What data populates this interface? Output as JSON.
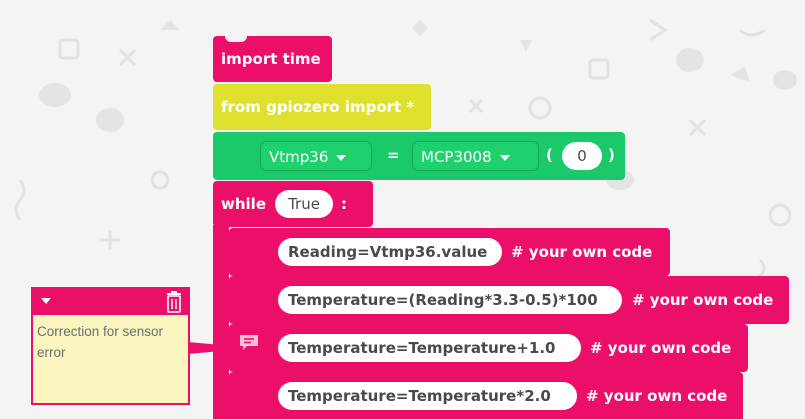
{
  "blocks": {
    "import_time": "import time",
    "from_gpiozero": "from gpiozero import *",
    "assign": {
      "variable": "Vtmp36",
      "equals": "=",
      "class_name": "MCP3008",
      "open_paren": "(",
      "channel": "0",
      "close_paren": ")"
    },
    "while_loop": {
      "keyword": "while",
      "condition": "True",
      "colon": ":"
    },
    "statements": [
      {
        "code": "Reading=Vtmp36.value",
        "comment": "# your own code"
      },
      {
        "code": "Temperature=(Reading*3.3-0.5)*100",
        "comment": "# your own code"
      },
      {
        "code": "Temperature=Temperature+1.0",
        "comment": "# your own code"
      },
      {
        "code": "Temperature=Temperature*2.0",
        "comment": "# your own code"
      }
    ]
  },
  "comment_bubble": {
    "text": "Correction for sensor error"
  },
  "colors": {
    "pink": "#ec0f6a",
    "yellow": "#dfe12e",
    "green": "#1bc96a",
    "comment_bg": "#fbf5c0"
  }
}
